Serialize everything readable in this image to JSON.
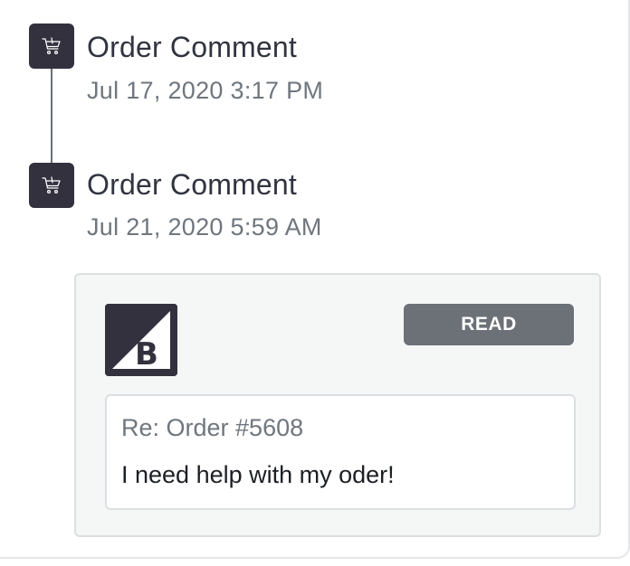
{
  "timeline": {
    "events": [
      {
        "title": "Order Comment",
        "date": "Jul 17, 2020 3:17 PM",
        "icon": "cart-icon"
      },
      {
        "title": "Order Comment",
        "date": "Jul 21, 2020 5:59 AM",
        "icon": "cart-icon"
      }
    ]
  },
  "comment_card": {
    "logo": "bigcommerce-logo",
    "read_label": "READ",
    "message": {
      "subject": "Re: Order #5608",
      "body": "I need help with my oder!"
    }
  },
  "colors": {
    "icon_bg": "#34313f",
    "button_bg": "#6b7177",
    "card_bg": "#f5f7f7"
  }
}
